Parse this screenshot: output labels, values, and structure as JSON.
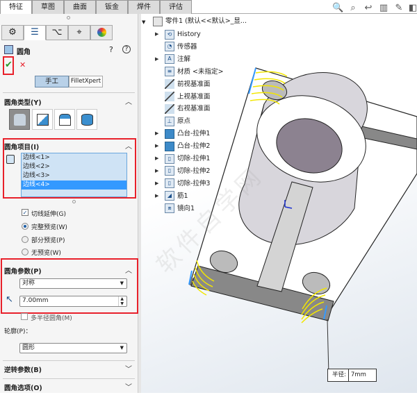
{
  "tabs": [
    "特征",
    "草图",
    "曲面",
    "钣金",
    "焊件",
    "评估"
  ],
  "panel": {
    "tabs": [
      "feature-manager",
      "property-manager",
      "configuration-manager",
      "dimxpert",
      "display-manager"
    ],
    "title": "圆角",
    "ok": "✔",
    "cancel": "✕",
    "mode_buttons": [
      "手工",
      "FilletXpert"
    ],
    "fillet_type": {
      "title": "圆角类型(Y)"
    },
    "fillet_items": {
      "title": "圆角项目(I)",
      "items": [
        "边线<1>",
        "边线<2>",
        "边线<3>",
        "边线<4>"
      ],
      "selected": 3
    },
    "options": {
      "tangent_propagation": "切线延伸(G)",
      "tangent_checked": true,
      "previews": [
        "完整预览(W)",
        "部分预览(P)",
        "无预览(W)"
      ],
      "preview_selected": 0
    },
    "fillet_params": {
      "title": "圆角参数(P)",
      "method": "对称",
      "radius": "7.00mm",
      "multi_radius": "多半径圆角(M)"
    },
    "profile": {
      "label": "轮廓(P)：",
      "value": "圆形"
    },
    "reverse_params": "逆转参数(B)",
    "fillet_options": "圆角选项(O)"
  },
  "tree": {
    "root": "零件1  (默认<<默认>_显...",
    "items": [
      {
        "label": "History",
        "icon": "history-folder",
        "exp": true
      },
      {
        "label": "传感器",
        "icon": "sensor-folder",
        "exp": false
      },
      {
        "label": "注解",
        "icon": "annotation-folder",
        "exp": true
      },
      {
        "label": "材质 <未指定>",
        "icon": "material",
        "exp": false
      },
      {
        "label": "前视基准面",
        "icon": "plane",
        "exp": false
      },
      {
        "label": "上视基准面",
        "icon": "plane",
        "exp": false
      },
      {
        "label": "右视基准面",
        "icon": "plane",
        "exp": false
      },
      {
        "label": "原点",
        "icon": "origin",
        "exp": false
      },
      {
        "label": "凸台-拉伸1",
        "icon": "boss-extrude",
        "exp": true
      },
      {
        "label": "凸台-拉伸2",
        "icon": "boss-extrude",
        "exp": true
      },
      {
        "label": "切除-拉伸1",
        "icon": "cut-extrude",
        "exp": true
      },
      {
        "label": "切除-拉伸2",
        "icon": "cut-extrude",
        "exp": true
      },
      {
        "label": "切除-拉伸3",
        "icon": "cut-extrude",
        "exp": true
      },
      {
        "label": "筋1",
        "icon": "rib",
        "exp": true
      },
      {
        "label": "镜向1",
        "icon": "mirror",
        "exp": false
      }
    ]
  },
  "callout": {
    "label": "半径:",
    "value": "7mm"
  },
  "colors": {
    "accent": "#3399ff",
    "highlight": "#e8202a",
    "fillet_preview": "#f2e600"
  }
}
